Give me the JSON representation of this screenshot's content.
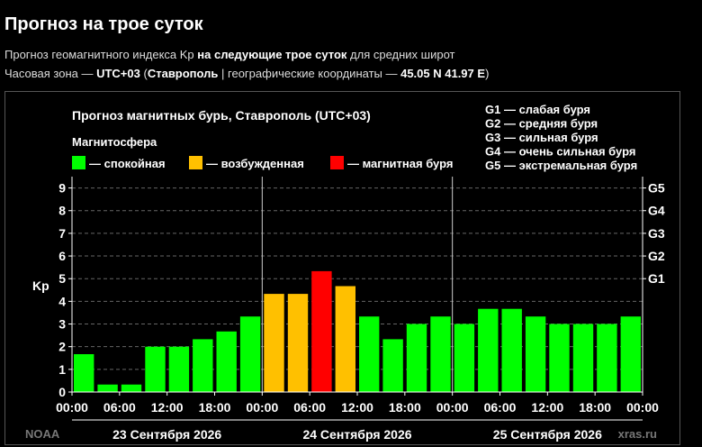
{
  "header": {
    "title": "Прогноз на трое суток",
    "line1_pre": "Прогноз геомагнитного индекса Kp ",
    "line1_bold": "на следующие трое суток",
    "line1_post": " для средних широт",
    "line2_pre": "Часовая зона — ",
    "line2_tz": "UTC+03",
    "line2_mid1": " (",
    "line2_city": "Ставрополь",
    "line2_mid2": " | географические координаты — ",
    "line2_coords": "45.05 N 41.97 E",
    "line2_post": ")"
  },
  "chart_data": {
    "type": "bar",
    "title": "Прогноз магнитных бурь, Ставрополь (UTC+03)",
    "ylabel": "Kp",
    "ylim": [
      0,
      9.5
    ],
    "yticks": [
      0,
      1,
      2,
      3,
      4,
      5,
      6,
      7,
      8,
      9
    ],
    "grid": true,
    "legend_title": "Магнитосфера",
    "legend": [
      {
        "label": "— спокойная",
        "color": "#00ff00"
      },
      {
        "label": "— возбужденная",
        "color": "#ffc000"
      },
      {
        "label": "— магнитная буря",
        "color": "#ff0000"
      }
    ],
    "g_scale": [
      "G1 — слабая буря",
      "G2 — средняя буря",
      "G3 — сильная буря",
      "G4 — очень сильная буря",
      "G5 — экстремальная буря"
    ],
    "right_ticks": [
      {
        "label": "G1",
        "value": 5
      },
      {
        "label": "G2",
        "value": 6
      },
      {
        "label": "G3",
        "value": 7
      },
      {
        "label": "G4",
        "value": 8
      },
      {
        "label": "G5",
        "value": 9
      }
    ],
    "x_tick_labels": [
      "00:00",
      "06:00",
      "12:00",
      "18:00",
      "00:00",
      "06:00",
      "12:00",
      "18:00",
      "00:00",
      "06:00",
      "12:00",
      "18:00",
      "00:00"
    ],
    "days": [
      "23 Сентября 2026",
      "24 Сентября 2026",
      "25 Сентября 2026"
    ],
    "values": [
      1.67,
      0.33,
      0.33,
      2.0,
      2.0,
      2.33,
      2.67,
      3.33,
      4.33,
      4.33,
      5.33,
      4.67,
      3.33,
      2.33,
      3.0,
      3.33,
      3.0,
      3.67,
      3.67,
      3.33,
      3.0,
      3.0,
      3.0,
      3.33
    ],
    "bar_levels": [
      "quiet",
      "quiet",
      "quiet",
      "quiet",
      "quiet",
      "quiet",
      "quiet",
      "quiet",
      "active",
      "active",
      "storm",
      "active",
      "quiet",
      "quiet",
      "quiet",
      "quiet",
      "quiet",
      "quiet",
      "quiet",
      "quiet",
      "quiet",
      "quiet",
      "quiet",
      "quiet"
    ],
    "level_colors": {
      "quiet": "#00ff00",
      "active": "#ffc000",
      "storm": "#ff0000"
    },
    "source_left": "NOAA",
    "source_right": "xras.ru"
  }
}
